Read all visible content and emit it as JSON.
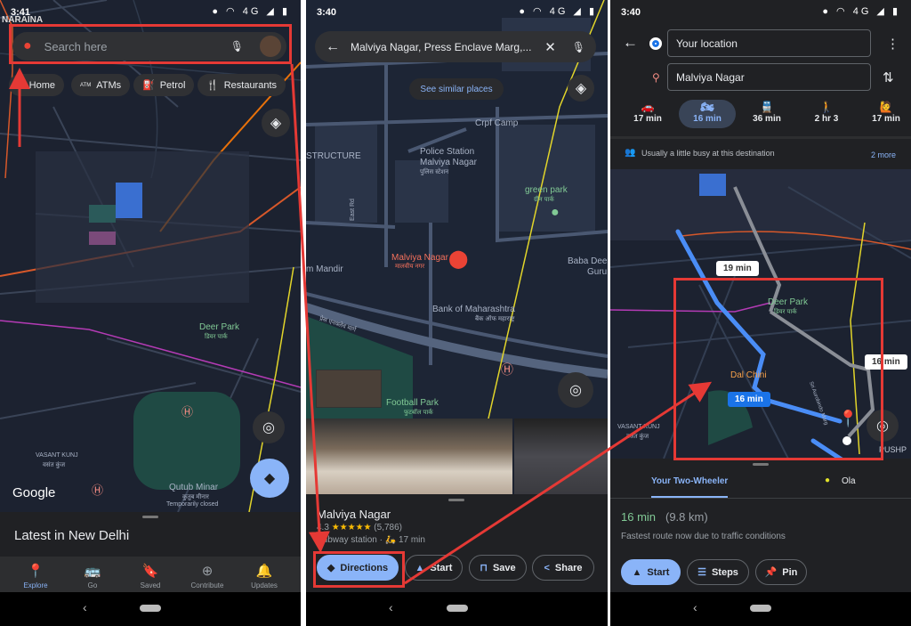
{
  "colors": {
    "annotation_red": "#e53935",
    "accent_blue": "#8ab4f8",
    "route_blue": "#4a8df6",
    "eta_green": "#81c995",
    "map_bg": "#1c2230"
  },
  "screen1": {
    "status": {
      "time": "3:41",
      "icons": "● ◠ 4G ◢ ▮"
    },
    "search": {
      "placeholder": "Search here",
      "logo": "maps-pin-logo",
      "mic": "mic-icon",
      "avatar": "avatar"
    },
    "chips": [
      {
        "label": "Home",
        "icon": "home-icon"
      },
      {
        "label": "ATMs",
        "icon": "atm-icon",
        "icon_text": "ATM"
      },
      {
        "label": "Petrol",
        "icon": "fuel-icon"
      },
      {
        "label": "Restaurants",
        "icon": "restaurant-icon"
      }
    ],
    "map_labels": {
      "top_left": "NARAINA",
      "deer_park": "Deer Park",
      "deer_park_hi": "डियर पार्क",
      "qutub": "Qutub Minar",
      "qutub_hi": "कुतुब मीनार",
      "qutub_status": "Temporarily closed",
      "vasant_kunj": "VASANT KUNJ",
      "vasant_kunj_hi": "वसंत कुंज",
      "google": "Google"
    },
    "sheet_title": "Latest in New Delhi",
    "nav": [
      {
        "label": "Explore",
        "icon": "explore-icon",
        "active": true
      },
      {
        "label": "Go",
        "icon": "commute-icon"
      },
      {
        "label": "Saved",
        "icon": "bookmark-icon"
      },
      {
        "label": "Contribute",
        "icon": "add-circle-icon"
      },
      {
        "label": "Updates",
        "icon": "bell-icon",
        "badge": true
      }
    ]
  },
  "screen2": {
    "status": {
      "time": "3:40",
      "icons": "● ◠ 4G ◢ ▮"
    },
    "search_value": "Malviya Nagar, Press Enclave Marg,...",
    "similar": "See similar places",
    "map_labels": {
      "crpf": "Crpf Camp",
      "police": "Police Station",
      "police2": "Malviya Nagar",
      "police_hi": "पुलिस स्टेशन",
      "structure": "STRUCTURE",
      "green_park": "green park",
      "green_park_hi": "ग्रीन पार्क",
      "place": "Malviya Nagar",
      "place_hi": "मालवीय नगर",
      "mandir": "m Mandir",
      "baba": "Baba Deep",
      "guru": "Guru",
      "bank": "Bank of Maharashtra",
      "bank_hi": "बैंक ऑफ महाराष्ट्र",
      "marg_hi": "प्रेस एनक्लेव मार्ग",
      "football": "Football Park",
      "football_hi": "फुटबॉल पार्क",
      "east_rd": "East Rd",
      "road": "Rd"
    },
    "place": {
      "title": "Malviya Nagar",
      "rating": "4.3",
      "stars": 5,
      "reviews": "(5,786)",
      "type": "Subway station",
      "travel": "17 min"
    },
    "actions": [
      {
        "label": "Directions",
        "icon": "directions-icon"
      },
      {
        "label": "Start",
        "icon": "navigation-icon"
      },
      {
        "label": "Save",
        "icon": "bookmark-icon"
      },
      {
        "label": "Share",
        "icon": "share-icon"
      }
    ]
  },
  "screen3": {
    "status": {
      "time": "3:40",
      "icons": "● ◠ 4G ◢ ▮"
    },
    "origin": "Your location",
    "destination": "Malviya Nagar",
    "modes": [
      {
        "icon": "car-icon",
        "time": "17 min"
      },
      {
        "icon": "two-wheeler-icon",
        "time": "16 min",
        "active": true
      },
      {
        "icon": "transit-icon",
        "time": "36 min"
      },
      {
        "icon": "walk-icon",
        "time": "2 hr 3"
      },
      {
        "icon": "ride-icon",
        "time": "17 min"
      }
    ],
    "busy": "Usually a little busy at this destination",
    "more": "2 more",
    "route_labels": {
      "alt1": "19 min",
      "alt2": "16 min",
      "main": "16 min",
      "deer_park": "Deer Park",
      "deer_park_hi": "डियर पार्क",
      "dal_chini": "Dal Chini",
      "vasant_kunj": "VASANT KUNJ",
      "vasant_kunj_hi": "वसंत कुंज",
      "road": "Sri Aurobindo Marg",
      "pushp": "PUSHP"
    },
    "tabs": [
      {
        "label": "Your Two-Wheeler",
        "active": true
      },
      {
        "label": "Ola"
      }
    ],
    "eta": "16 min",
    "distance": "(9.8 km)",
    "note": "Fastest route now due to traffic conditions",
    "actions": [
      {
        "label": "Start",
        "icon": "navigation-icon"
      },
      {
        "label": "Steps",
        "icon": "list-icon"
      },
      {
        "label": "Pin",
        "icon": "pin-icon"
      }
    ]
  }
}
